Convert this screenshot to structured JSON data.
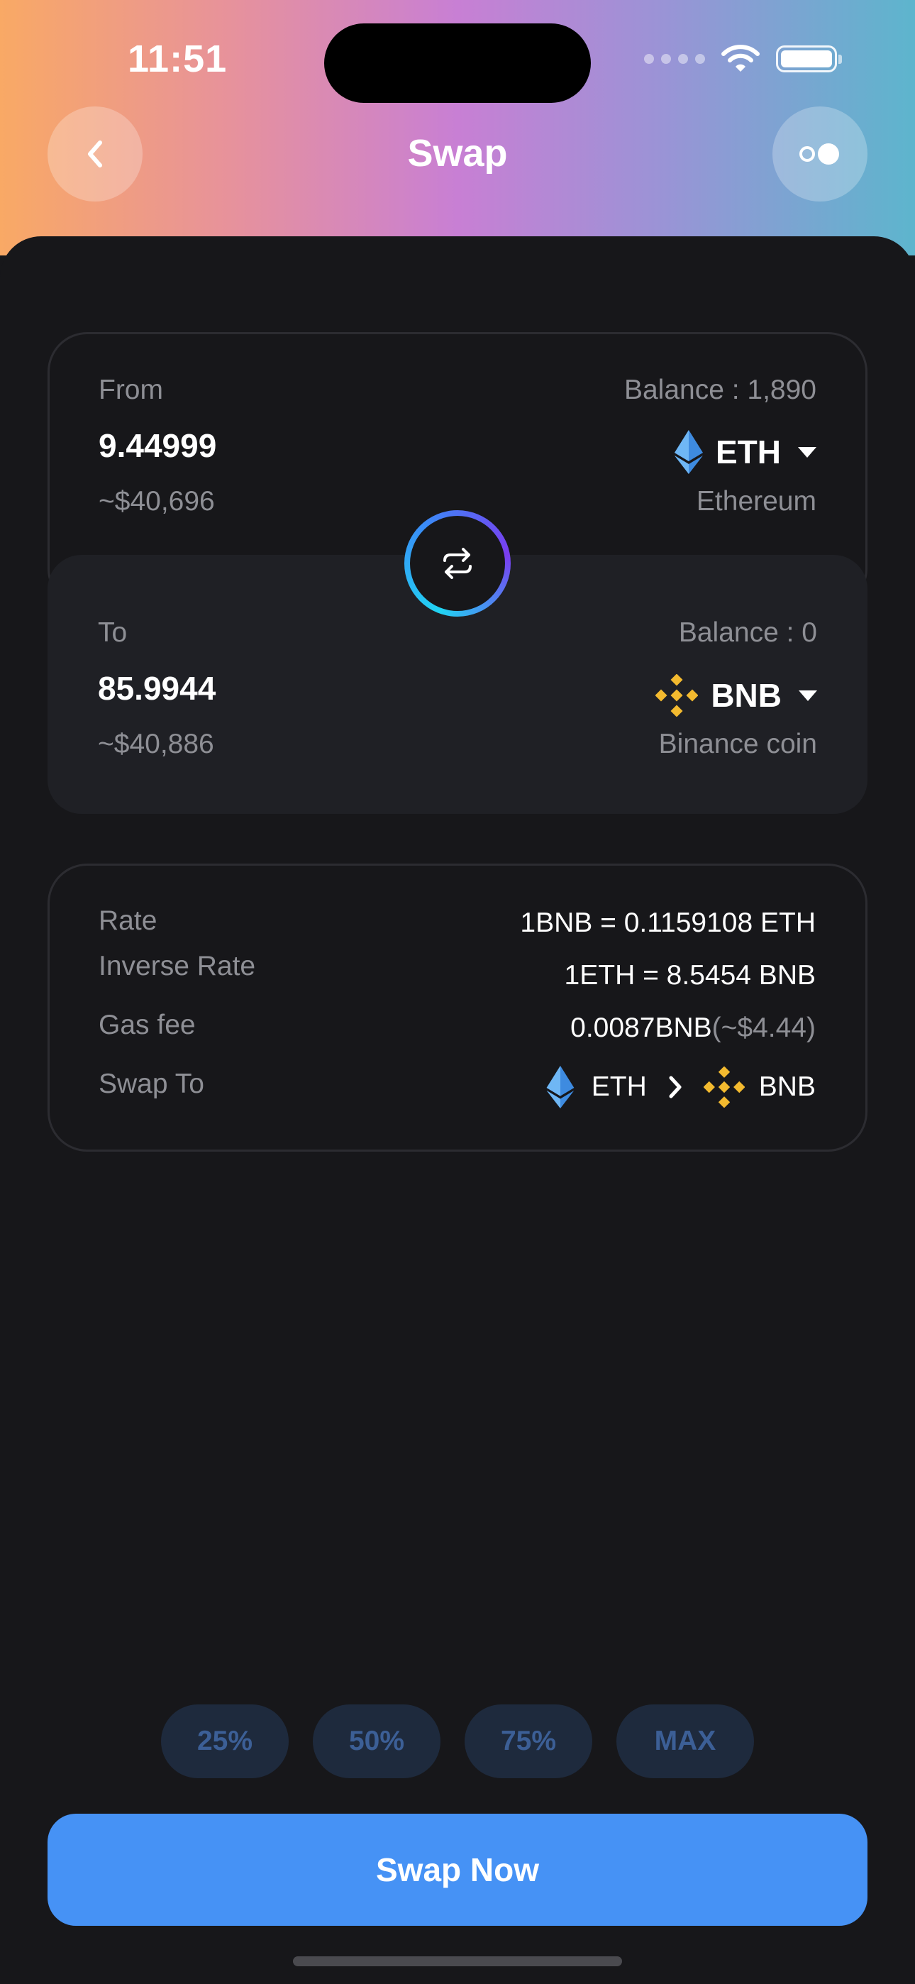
{
  "status": {
    "time": "11:51"
  },
  "header": {
    "title": "Swap"
  },
  "from": {
    "label": "From",
    "balance": "Balance : 1,890",
    "amount": "9.44999",
    "usd": "~$40,696",
    "symbol": "ETH",
    "name": "Ethereum"
  },
  "to": {
    "label": "To",
    "balance": "Balance : 0",
    "amount": "85.9944",
    "usd": "~$40,886",
    "symbol": "BNB",
    "name": "Binance coin"
  },
  "details": {
    "rate_label": "Rate",
    "rate_value": "1BNB = 0.1159108 ETH",
    "inverse_label": "Inverse Rate",
    "inverse_value": "1ETH = 8.5454 BNB",
    "gas_label": "Gas fee",
    "gas_value": "0.0087BNB",
    "gas_usd": "(~$4.44)",
    "swapto_label": "Swap To",
    "route_from": "ETH",
    "route_to": "BNB"
  },
  "percent_options": [
    "25%",
    "50%",
    "75%",
    "MAX"
  ],
  "action": {
    "label": "Swap Now"
  },
  "colors": {
    "accent": "#4692f5",
    "eth": "#3e8be0",
    "bnb": "#f3ba2f"
  }
}
